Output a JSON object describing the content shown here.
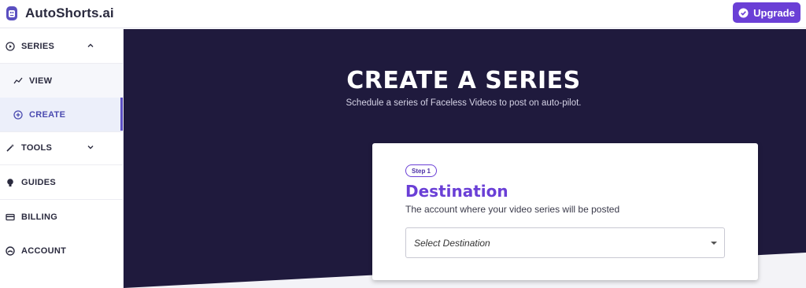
{
  "app": {
    "name": "AutoShorts.ai",
    "upgrade_label": "Upgrade",
    "accent_color": "#6a3fd6"
  },
  "sidebar": {
    "items": [
      {
        "label": "SERIES",
        "icon": "play-circle-icon",
        "expanded": true
      },
      {
        "label": "VIEW",
        "icon": "trend-line-icon"
      },
      {
        "label": "CREATE",
        "icon": "plus-circle-icon",
        "active": true
      },
      {
        "label": "TOOLS",
        "icon": "magic-wand-icon",
        "expanded": false
      },
      {
        "label": "GUIDES",
        "icon": "lightbulb-icon"
      },
      {
        "label": "BILLING",
        "icon": "credit-card-icon"
      },
      {
        "label": "ACCOUNT",
        "icon": "account-icon"
      }
    ]
  },
  "hero": {
    "title": "CREATE A SERIES",
    "subtitle": "Schedule a series of Faceless Videos to post on auto-pilot."
  },
  "step": {
    "badge": "Step 1",
    "title": "Destination",
    "description": "The account where your video series will be posted",
    "select_placeholder": "Select Destination"
  }
}
